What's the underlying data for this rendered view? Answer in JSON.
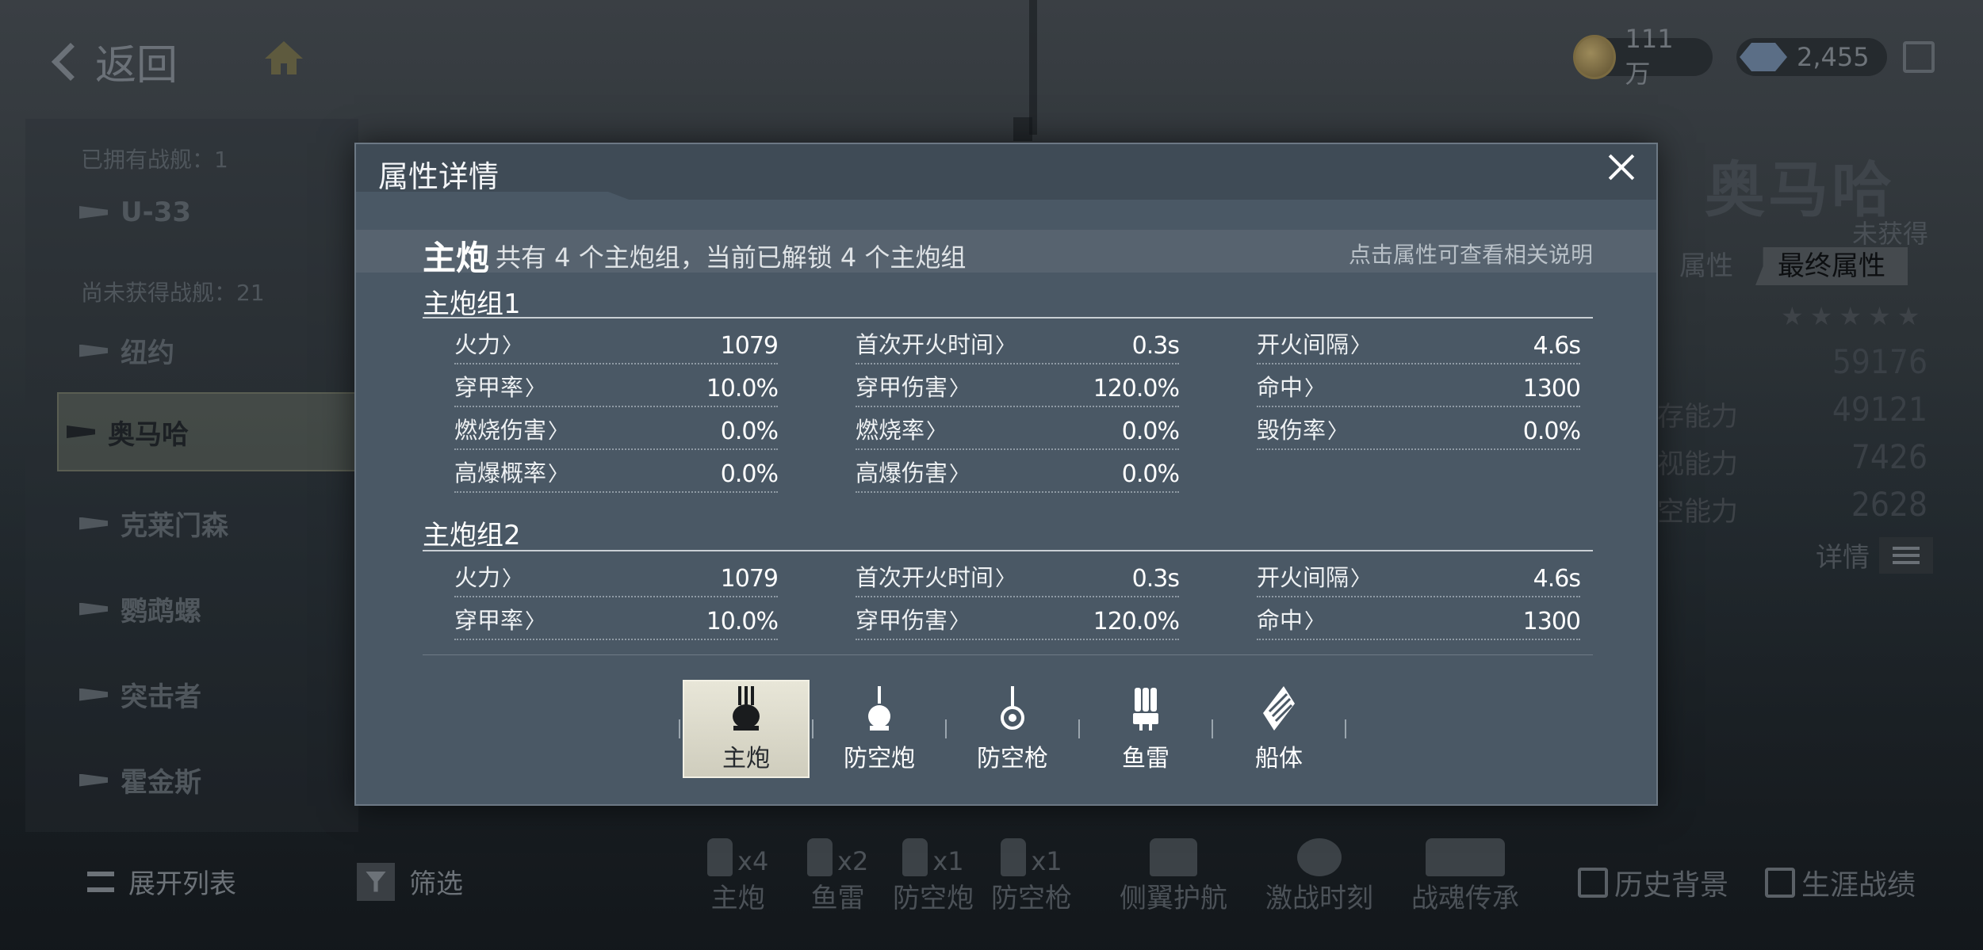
{
  "top_bar": {
    "back_label": "返回",
    "coins": "111万",
    "gems": "2,455"
  },
  "left_panel": {
    "owned_label": "已拥有战舰：1",
    "not_owned_label": "尚未获得战舰：21",
    "ships": [
      "U-33",
      "纽约",
      "奥马哈",
      "克莱门森",
      "鹦鹉螺",
      "突击者",
      "霍金斯"
    ],
    "selected_ship": "奥马哈",
    "expand_list": "展开列表",
    "filter": "筛选"
  },
  "right_panel": {
    "ship_name": "奥马哈",
    "status": "未获得",
    "tabs": [
      "属性",
      "最终属性"
    ],
    "active_tab": "最终属性",
    "stars": "★★★★★",
    "total": "59176",
    "stats": [
      {
        "label": "存能力",
        "value": "49121"
      },
      {
        "label": "视能力",
        "value": "7426"
      },
      {
        "label": "空能力",
        "value": "2628"
      }
    ],
    "detail_label": "详情"
  },
  "bottom_toolbar": {
    "items": [
      {
        "label": "主炮",
        "count": "x4"
      },
      {
        "label": "鱼雷",
        "count": "x2"
      },
      {
        "label": "防空炮",
        "count": "x1"
      },
      {
        "label": "防空枪",
        "count": "x1"
      }
    ],
    "actions": [
      "侧翼护航",
      "激战时刻",
      "战魂传承"
    ],
    "history": "历史背景",
    "career": "生涯战绩"
  },
  "modal": {
    "title": "属性详情",
    "section": {
      "title": "主炮",
      "subtitle": "共有 4 个主炮组，当前已解锁 4 个主炮组",
      "hint": "点击属性可查看相关说明"
    },
    "groups": [
      {
        "title": "主炮组1",
        "stats": [
          {
            "label": "火力",
            "value": "1079"
          },
          {
            "label": "首次开火时间",
            "value": "0.3s"
          },
          {
            "label": "开火间隔",
            "value": "4.6s"
          },
          {
            "label": "穿甲率",
            "value": "10.0%"
          },
          {
            "label": "穿甲伤害",
            "value": "120.0%"
          },
          {
            "label": "命中",
            "value": "1300"
          },
          {
            "label": "燃烧伤害",
            "value": "0.0%"
          },
          {
            "label": "燃烧率",
            "value": "0.0%"
          },
          {
            "label": "毁伤率",
            "value": "0.0%"
          },
          {
            "label": "高爆概率",
            "value": "0.0%"
          },
          {
            "label": "高爆伤害",
            "value": "0.0%"
          }
        ]
      },
      {
        "title": "主炮组2",
        "stats": [
          {
            "label": "火力",
            "value": "1079"
          },
          {
            "label": "首次开火时间",
            "value": "0.3s"
          },
          {
            "label": "开火间隔",
            "value": "4.6s"
          },
          {
            "label": "穿甲率",
            "value": "10.0%"
          },
          {
            "label": "穿甲伤害",
            "value": "120.0%"
          },
          {
            "label": "命中",
            "value": "1300"
          }
        ]
      }
    ],
    "tabs": [
      "主炮",
      "防空炮",
      "防空枪",
      "鱼雷",
      "船体"
    ],
    "active_tab": "主炮"
  }
}
